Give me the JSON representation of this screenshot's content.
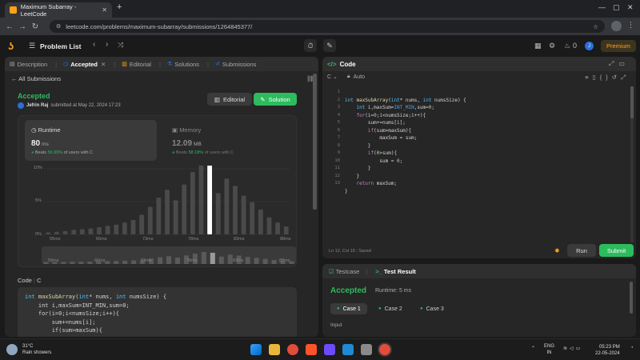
{
  "browser": {
    "tab_title": "Maximum Subarray - LeetCode",
    "url": "leetcode.com/problems/maximum-subarray/submissions/1264845377/"
  },
  "header": {
    "problem_list": "Problem List",
    "premium": "Premium",
    "streak": "0",
    "user_initial": "J"
  },
  "left_tabs": {
    "description": "Description",
    "accepted": "Accepted",
    "editorial": "Editorial",
    "solutions": "Solutions",
    "submissions": "Submissions"
  },
  "submission": {
    "back": "All Submissions",
    "status": "Accepted",
    "user": "Jefrin Raj",
    "submitted": "submitted at May 22, 2024 17:23",
    "editorial_btn": "Editorial",
    "solution_btn": "Solution"
  },
  "runtime": {
    "title": "Runtime",
    "value": "80",
    "unit": "ms",
    "beats_prefix": "Beats",
    "beats_pct": "56.99%",
    "beats_suffix": "of users with C"
  },
  "memory": {
    "title": "Memory",
    "value": "12.09",
    "unit": "MB",
    "beats_prefix": "Beats",
    "beats_pct": "58.18%",
    "beats_suffix": "of users with C"
  },
  "chart_data": {
    "type": "bar",
    "y_ticks": [
      "10%",
      "5%",
      "0%"
    ],
    "x_ticks": [
      "55ms",
      "66ms",
      "73ms",
      "78ms",
      "83ms",
      "88ms"
    ],
    "mini_x_ticks": [
      "59ms",
      "66ms",
      "73ms",
      "78ms",
      "83ms",
      "88ms"
    ],
    "ylim": [
      0,
      10
    ],
    "values": [
      0.3,
      0.4,
      0.5,
      0.7,
      0.8,
      0.9,
      1.1,
      1.3,
      1.5,
      1.8,
      2.2,
      3.0,
      4.2,
      5.6,
      6.8,
      5.2,
      7.6,
      9.5,
      11.3,
      10.5,
      6.3,
      8.5,
      7.4,
      5.9,
      4.9,
      3.8,
      2.6,
      1.8,
      1.2
    ],
    "highlight_index": 19,
    "marker_label": "J",
    "grid": true
  },
  "code_section": {
    "label": "Code",
    "lang": "C",
    "lines": [
      "int maxSubArray(int* nums, int numsSize) {",
      "    int i,maxSum=INT_MIN,sum=0;",
      "    for(i=0;i<numsSize;i++){",
      "        sum+=nums[i];",
      "        if(sum>maxSum){"
    ]
  },
  "editor": {
    "title": "Code",
    "lang": "C",
    "mode": "Auto",
    "lines": [
      "int maxSubArray(int* nums, int numsSize) {",
      "    int i,maxSum=INT_MIN,sum=0;",
      "    for(i=0;i<numsSize;i++){",
      "        sum+=nums[i];",
      "        if(sum>maxSum){",
      "            maxSum = sum;",
      "        }",
      "        if(0>sum){",
      "            sum = 0;",
      "        }",
      "    }",
      "    return maxSum;",
      "}"
    ],
    "line_numbers": [
      "1",
      "2",
      "3",
      "4",
      "5",
      "6",
      "7",
      "8",
      "9",
      "10",
      "11",
      "12",
      "13"
    ],
    "status": "Ln 12, Col 19",
    "saved": "Saved",
    "run": "Run",
    "submit": "Submit"
  },
  "test": {
    "testcase_tab": "Testcase",
    "result_tab": "Test Result",
    "status": "Accepted",
    "runtime": "Runtime: 5 ms",
    "cases": [
      "Case 1",
      "Case 2",
      "Case 3"
    ],
    "input_label": "Input"
  },
  "taskbar": {
    "temp": "31°C",
    "weather": "Rain showers",
    "lang1": "ENG",
    "lang2": "IN",
    "time": "05:23 PM",
    "date": "22-05-2024"
  },
  "colors": {
    "accent_green": "#2cbb5d",
    "brand_orange": "#ffa116"
  }
}
